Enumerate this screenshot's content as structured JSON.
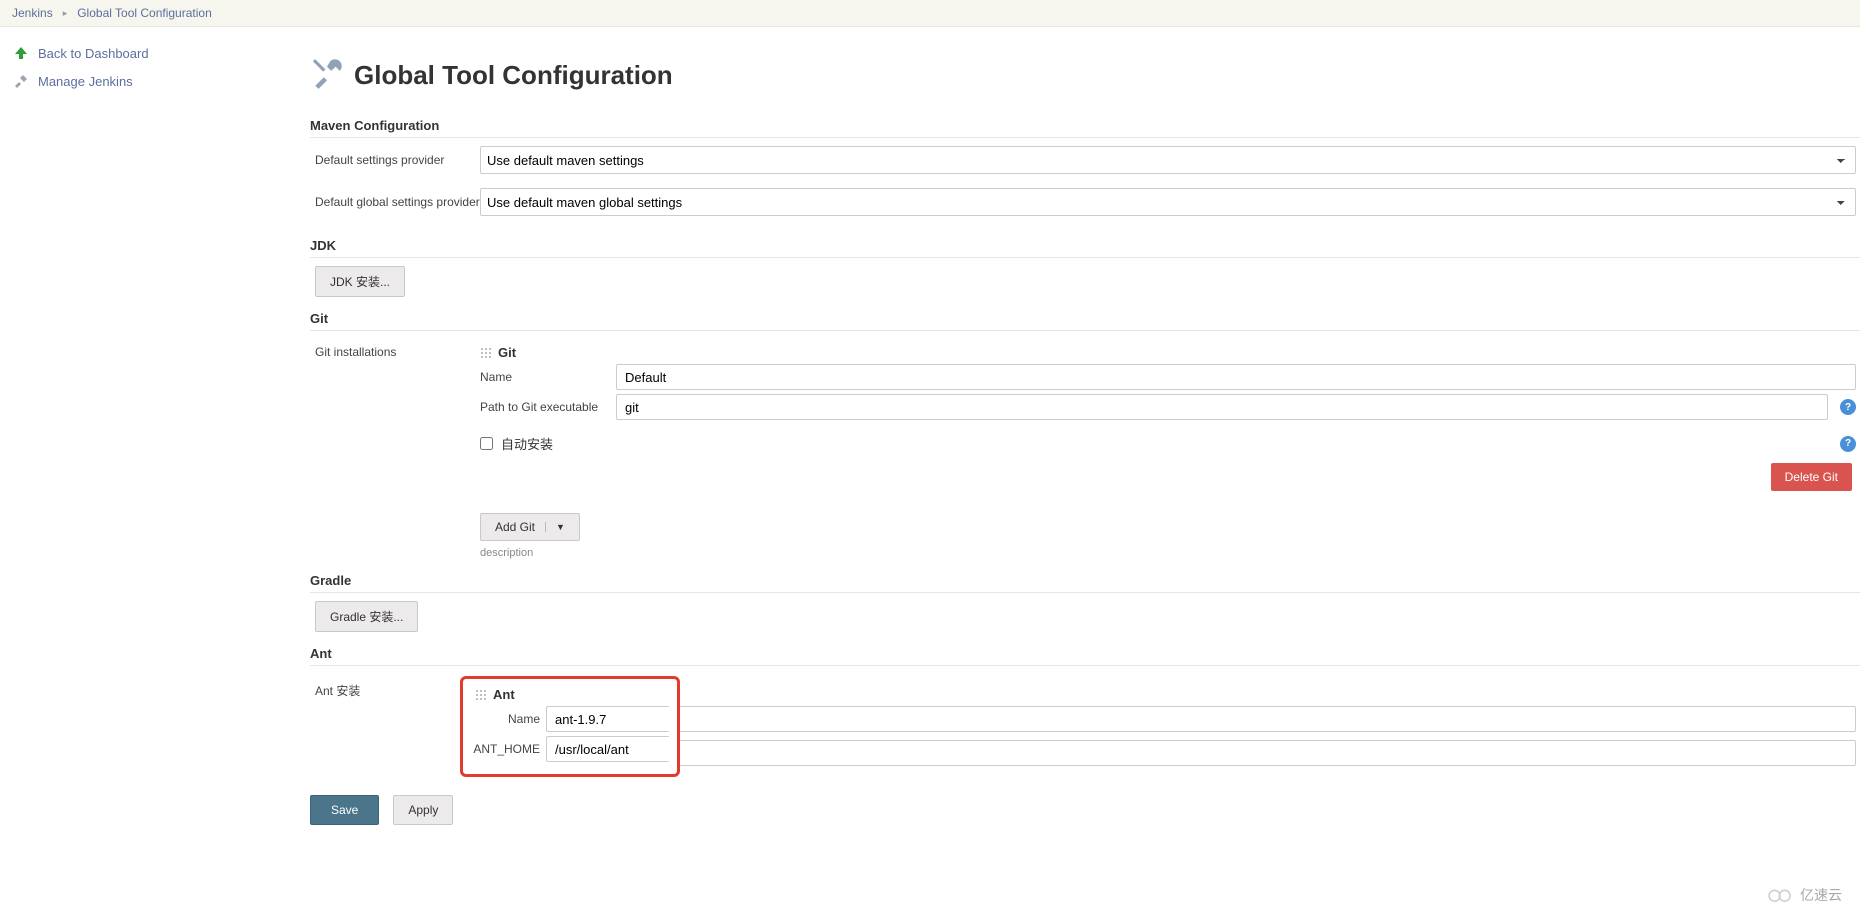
{
  "breadcrumb": {
    "items": [
      "Jenkins",
      "Global Tool Configuration"
    ]
  },
  "sidebar": {
    "back": "Back to Dashboard",
    "manage": "Manage Jenkins"
  },
  "page": {
    "title": "Global Tool Configuration"
  },
  "maven": {
    "section": "Maven Configuration",
    "default_label": "Default settings provider",
    "default_value": "Use default maven settings",
    "global_label": "Default global settings provider",
    "global_value": "Use default maven global settings"
  },
  "jdk": {
    "section": "JDK",
    "button": "JDK 安装..."
  },
  "git": {
    "section": "Git",
    "installations_label": "Git installations",
    "tool_title": "Git",
    "name_label": "Name",
    "name_value": "Default",
    "path_label": "Path to Git executable",
    "path_value": "git",
    "auto_install": "自动安装",
    "delete_btn": "Delete Git",
    "add_btn": "Add Git",
    "description": "description"
  },
  "gradle": {
    "section": "Gradle",
    "button": "Gradle 安装..."
  },
  "ant": {
    "section": "Ant",
    "installations_label": "Ant 安装",
    "tool_title": "Ant",
    "name_label": "Name",
    "name_value": "ant-1.9.7",
    "home_label": "ANT_HOME",
    "home_value": "/usr/local/ant"
  },
  "buttons": {
    "save": "Save",
    "apply": "Apply"
  },
  "watermark": "亿速云"
}
